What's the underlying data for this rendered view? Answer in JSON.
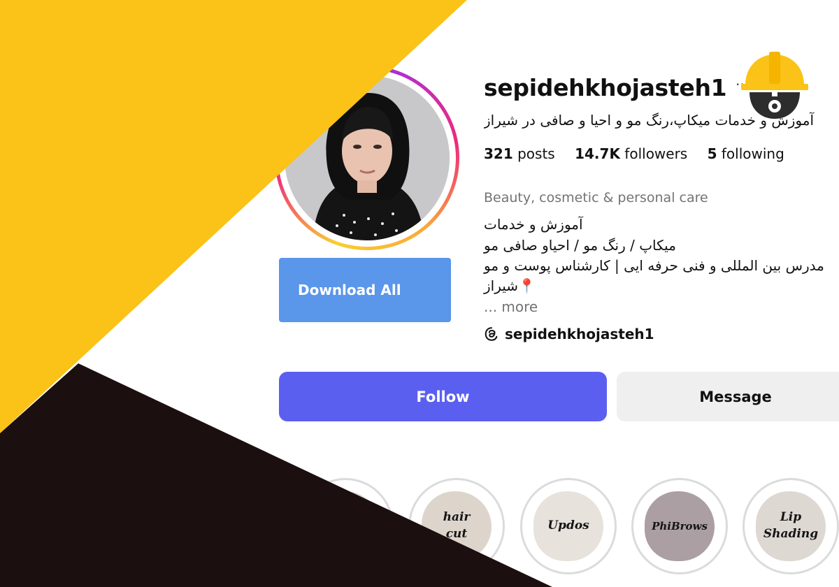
{
  "profile": {
    "username": "sepidehkhojasteh1",
    "more_dots": "...",
    "full_name": "آموزش و خدمات میکاپ،رنگ مو و احیا و صافی در شیراز",
    "stats": [
      {
        "number": "321",
        "label": "posts"
      },
      {
        "number": "14.7K",
        "label": "followers"
      },
      {
        "number": "5",
        "label": "following"
      }
    ],
    "category": "Beauty, cosmetic & personal care",
    "bio_lines": [
      "آموزش و خدمات",
      "میکاپ / رنگ مو / احیاو صافی مو",
      "مدرس بین المللی و فنی حرفه ایی | کارشناس پوست و مو",
      "📍شیراز"
    ],
    "more_label": "... more",
    "threads_handle": "sepidehkhojasteh1"
  },
  "buttons": {
    "download_all": "Download All",
    "follow": "Follow",
    "message": "Message"
  },
  "highlights": [
    {
      "label": ""
    },
    {
      "label": "hair cut"
    },
    {
      "label": "Updos"
    },
    {
      "label": "PhiBrows"
    },
    {
      "label": "Lip Shading"
    }
  ],
  "colors": {
    "accent_yellow": "#fbc217",
    "dark_panel": "#1b0f10",
    "follow_button": "#5b5ff0",
    "download_button": "#5a96ea",
    "message_button": "#efefef"
  },
  "icons": [
    "threads-icon",
    "construction-helmet-gear-icon",
    "location-pin-icon"
  ]
}
